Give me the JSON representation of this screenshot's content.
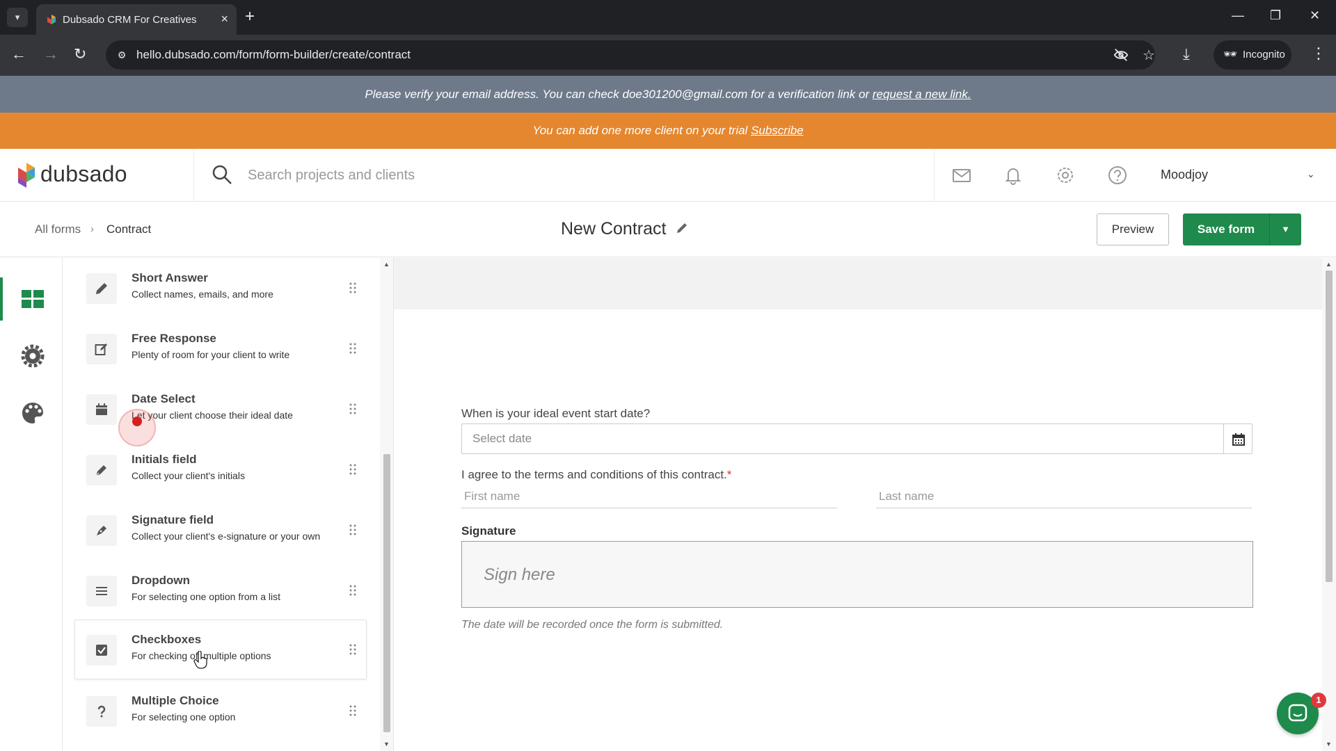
{
  "browser": {
    "tab_title": "Dubsado CRM For Creatives",
    "url": "hello.dubsado.com/form/form-builder/create/contract",
    "incognito_label": "Incognito"
  },
  "banners": {
    "verify_text": "Please verify your email address. You can check doe301200@gmail.com for a verification link or ",
    "verify_link": "request a new link.",
    "trial_text": "You can add one more client on your trial ",
    "trial_link": "Subscribe"
  },
  "header": {
    "logo_text": "dubsado",
    "search_placeholder": "Search projects and clients",
    "user_name": "Moodjoy"
  },
  "formbar": {
    "breadcrumb_root": "All forms",
    "breadcrumb_current": "Contract",
    "title": "New Contract",
    "preview_label": "Preview",
    "save_label": "Save form"
  },
  "palette": {
    "items": [
      {
        "title": "Short Answer",
        "desc": "Collect names, emails, and more",
        "icon": "pencil-icon"
      },
      {
        "title": "Free Response",
        "desc": "Plenty of room for your client to write",
        "icon": "edit-square-icon"
      },
      {
        "title": "Date Select",
        "desc": "Let your client choose their ideal date",
        "icon": "calendar-icon"
      },
      {
        "title": "Initials field",
        "desc": "Collect your client's initials",
        "icon": "pen-icon"
      },
      {
        "title": "Signature field",
        "desc": "Collect your client's e-signature or your own",
        "icon": "signature-pen-icon"
      },
      {
        "title": "Dropdown",
        "desc": "For selecting one option from a list",
        "icon": "list-icon"
      },
      {
        "title": "Checkboxes",
        "desc": "For checking off multiple options",
        "icon": "checkbox-icon"
      },
      {
        "title": "Multiple Choice",
        "desc": "For selecting one option",
        "icon": "question-icon"
      }
    ]
  },
  "canvas": {
    "date_question": "When is your ideal event start date?",
    "date_placeholder": "Select date",
    "agree_label": "I agree to the terms and conditions of this contract.",
    "required_mark": "*",
    "first_name_placeholder": "First name",
    "last_name_placeholder": "Last name",
    "signature_label": "Signature",
    "signature_placeholder": "Sign here",
    "signature_note": "The date will be recorded once the form is submitted."
  },
  "chat": {
    "badge_count": "1"
  },
  "colors": {
    "brand_green": "#1e8a4c",
    "trial_orange": "#e5872e",
    "verify_gray": "#6e7a8a"
  }
}
